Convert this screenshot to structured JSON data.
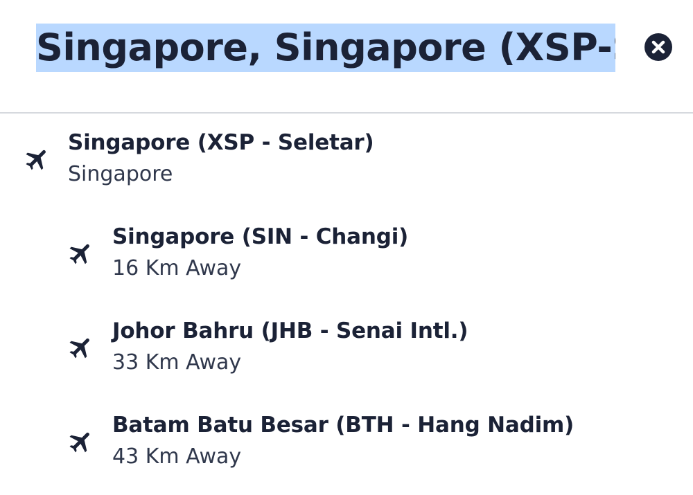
{
  "search": {
    "value": "Singapore, Singapore (XSP-Seletar)"
  },
  "icons": {
    "clear": "close-circle-icon",
    "result": "airplane-icon"
  },
  "colors": {
    "text": "#1b2236",
    "selection": "#b9d8ff",
    "divider": "#d6d9de"
  },
  "results": [
    {
      "title": "Singapore (XSP - Seletar)",
      "subtitle": "Singapore"
    },
    {
      "title": "Singapore (SIN - Changi)",
      "subtitle": "16 Km Away"
    },
    {
      "title": "Johor Bahru (JHB - Senai Intl.)",
      "subtitle": "33 Km Away"
    },
    {
      "title": "Batam Batu Besar (BTH - Hang Nadim)",
      "subtitle": "43 Km Away"
    }
  ]
}
